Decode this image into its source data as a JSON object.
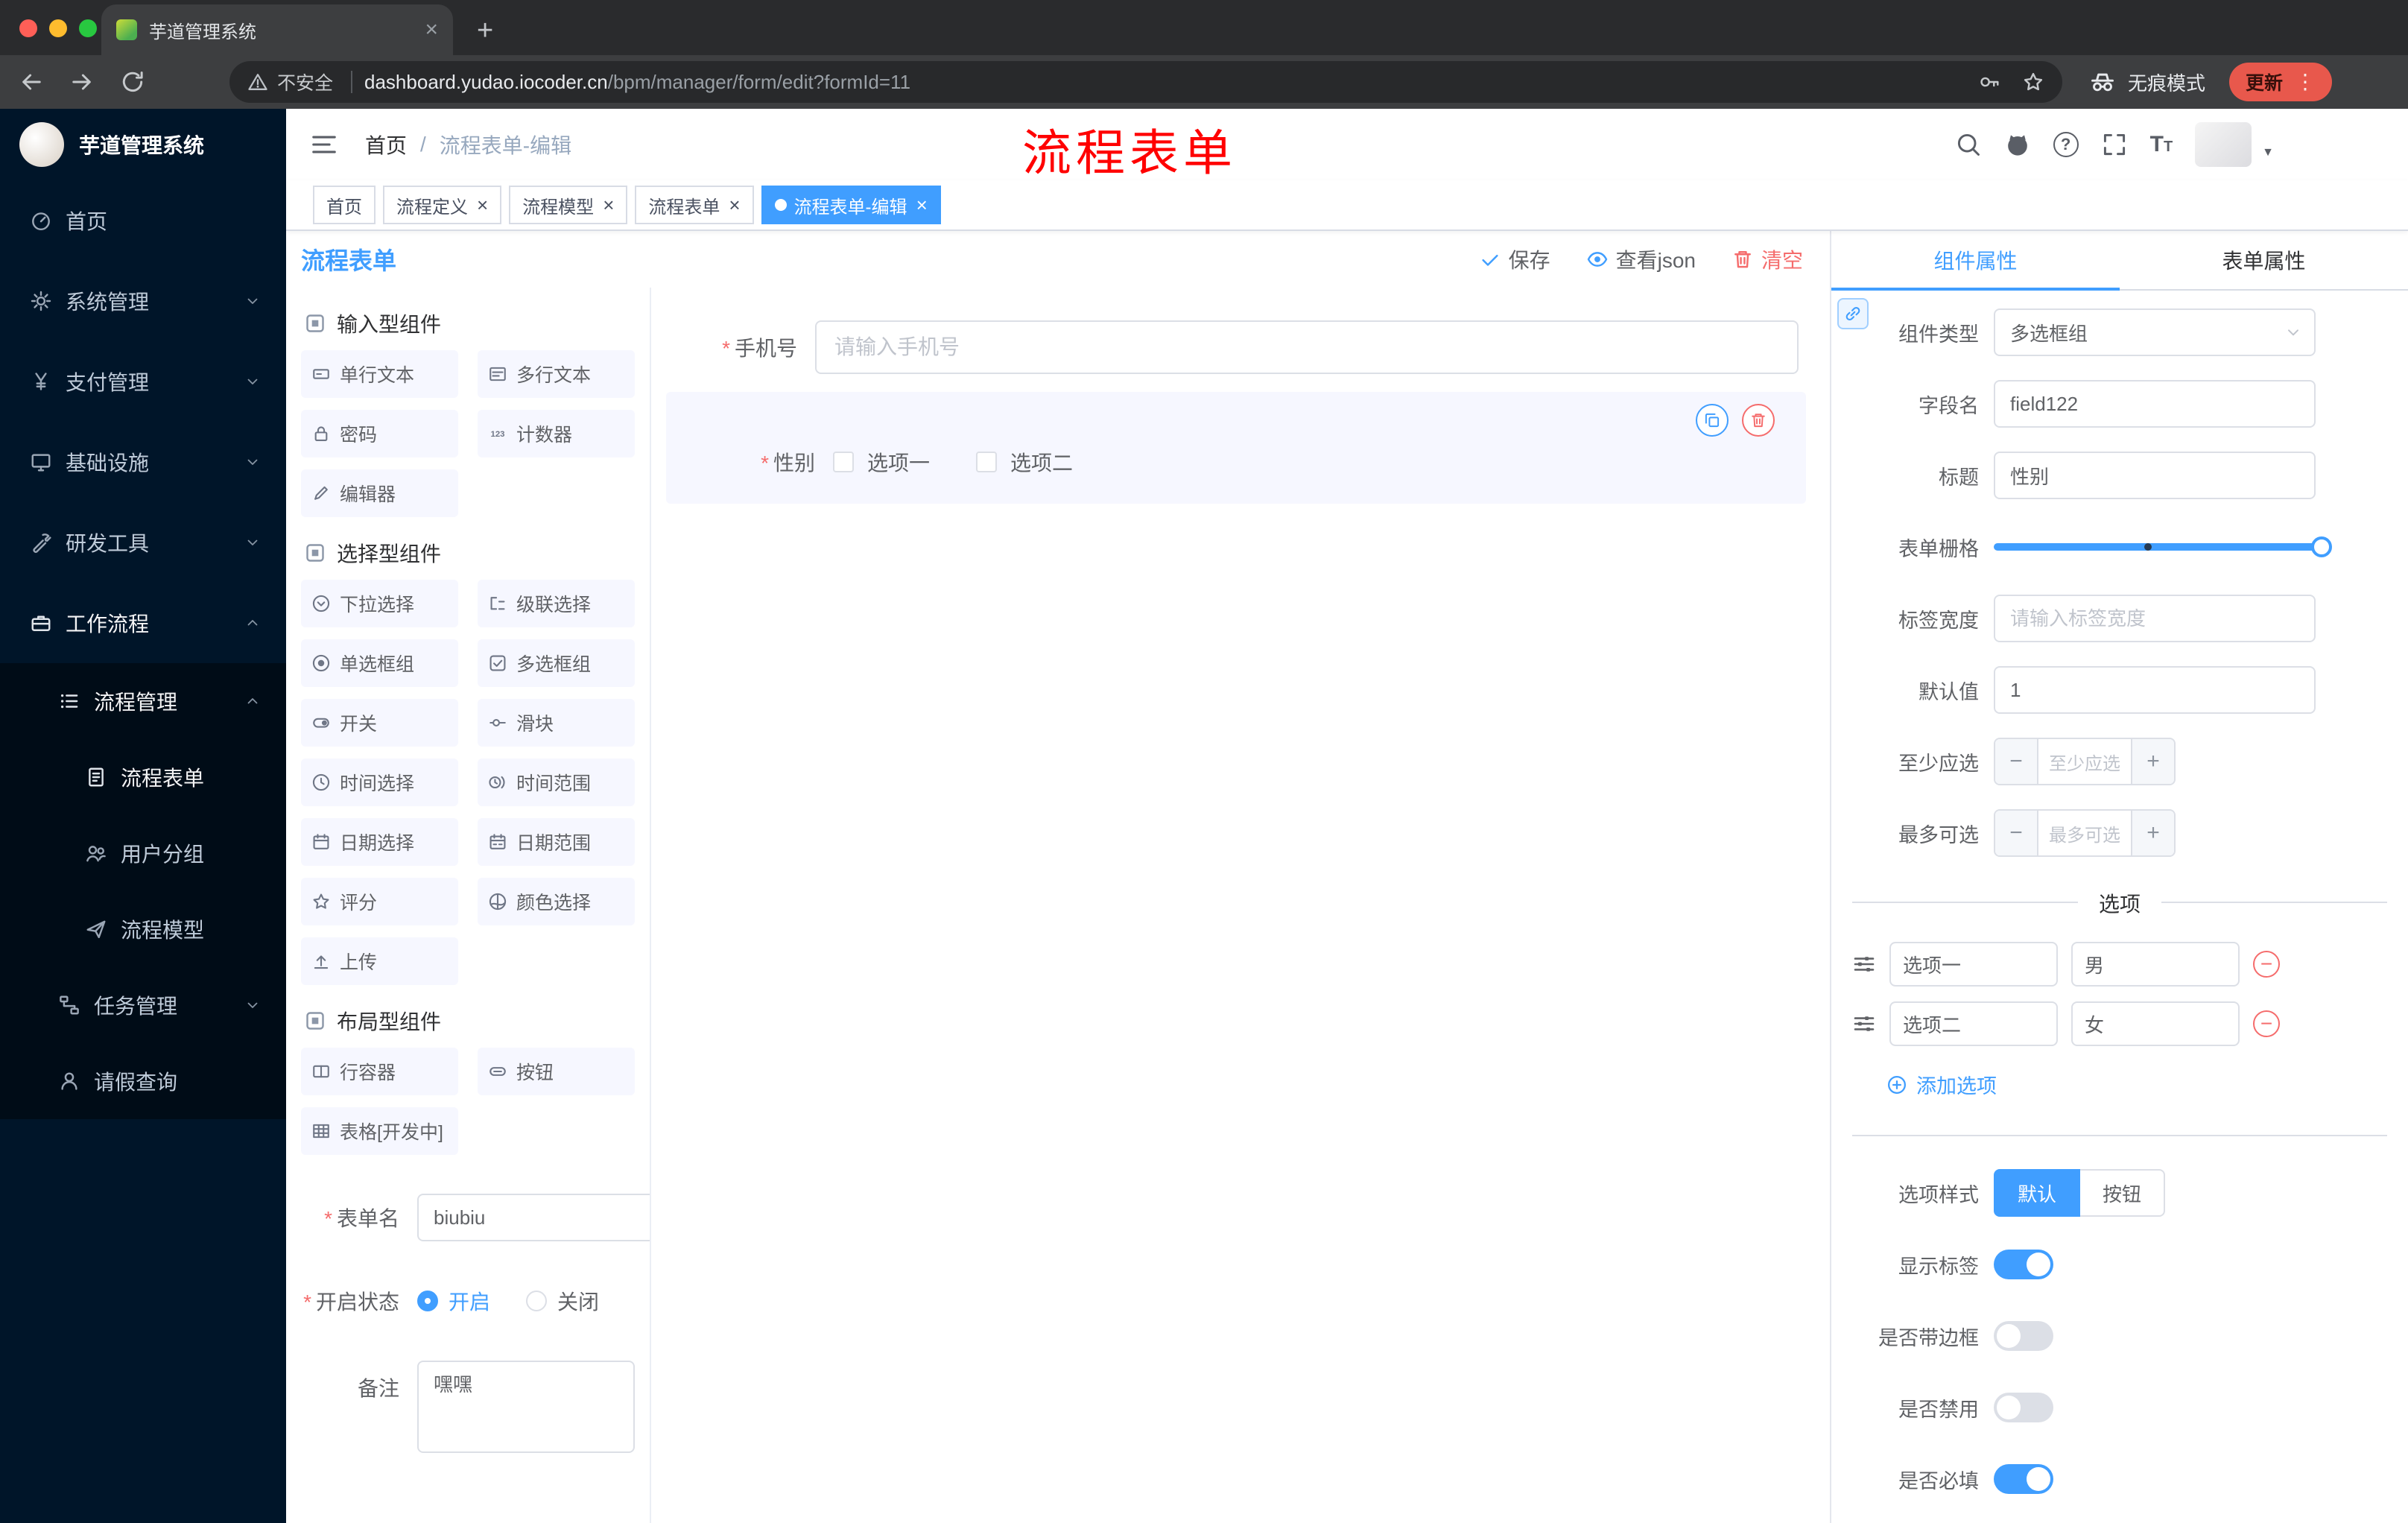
{
  "browser": {
    "tab_title": "芋道管理系统",
    "security_label": "不安全",
    "url_host": "dashboard.yudao.iocoder.cn",
    "url_path": "/bpm/manager/form/edit?formId=11",
    "incognito_label": "无痕模式",
    "update_label": "更新"
  },
  "sidebar": {
    "logo_title": "芋道管理系统",
    "items": [
      {
        "key": "home",
        "label": "首页",
        "icon": "dashboard",
        "depth": 0
      },
      {
        "key": "system",
        "label": "系统管理",
        "icon": "gear",
        "depth": 0,
        "chevron": "down"
      },
      {
        "key": "payment",
        "label": "支付管理",
        "icon": "yen",
        "depth": 0,
        "chevron": "down"
      },
      {
        "key": "infrastructure",
        "label": "基础设施",
        "icon": "infra",
        "depth": 0,
        "chevron": "down"
      },
      {
        "key": "devtools",
        "label": "研发工具",
        "icon": "tool",
        "depth": 0,
        "chevron": "down"
      },
      {
        "key": "workflow",
        "label": "工作流程",
        "icon": "workflow",
        "depth": 0,
        "chevron": "up",
        "trail": true
      },
      {
        "key": "process-management",
        "label": "流程管理",
        "icon": "process",
        "depth": 1,
        "chevron": "up",
        "trail": true
      },
      {
        "key": "process-form",
        "label": "流程表单",
        "icon": "form",
        "depth": 2,
        "active": true
      },
      {
        "key": "user-group",
        "label": "用户分组",
        "icon": "users",
        "depth": 2
      },
      {
        "key": "process-model",
        "label": "流程模型",
        "icon": "send",
        "depth": 2
      },
      {
        "key": "task-management",
        "label": "任务管理",
        "icon": "task",
        "depth": 1,
        "chevron": "down"
      },
      {
        "key": "leave-query",
        "label": "请假查询",
        "icon": "user",
        "depth": 1
      }
    ]
  },
  "header": {
    "breadcrumb": [
      "首页",
      "流程表单-编辑"
    ],
    "annotation": "流程表单"
  },
  "tags": [
    {
      "label": "首页",
      "closable": false,
      "active": false
    },
    {
      "label": "流程定义",
      "closable": true,
      "active": false
    },
    {
      "label": "流程模型",
      "closable": true,
      "active": false
    },
    {
      "label": "流程表单",
      "closable": true,
      "active": false
    },
    {
      "label": "流程表单-编辑",
      "closable": true,
      "active": true
    }
  ],
  "workspace": {
    "title": "流程表单",
    "actions": {
      "save": "保存",
      "view_json": "查看json",
      "clear": "清空"
    }
  },
  "palette": {
    "sections": [
      {
        "title": "输入型组件",
        "items": [
          {
            "label": "单行文本",
            "icon": "input"
          },
          {
            "label": "多行文本",
            "icon": "textarea"
          },
          {
            "label": "密码",
            "icon": "lock"
          },
          {
            "label": "计数器",
            "icon": "counter"
          },
          {
            "label": "编辑器",
            "icon": "editor"
          }
        ]
      },
      {
        "title": "选择型组件",
        "items": [
          {
            "label": "下拉选择",
            "icon": "select"
          },
          {
            "label": "级联选择",
            "icon": "cascade"
          },
          {
            "label": "单选框组",
            "icon": "radio"
          },
          {
            "label": "多选框组",
            "icon": "checkbox"
          },
          {
            "label": "开关",
            "icon": "switch"
          },
          {
            "label": "滑块",
            "icon": "slider"
          },
          {
            "label": "时间选择",
            "icon": "clock"
          },
          {
            "label": "时间范围",
            "icon": "clock-range"
          },
          {
            "label": "日期选择",
            "icon": "calendar"
          },
          {
            "label": "日期范围",
            "icon": "calendar-range"
          },
          {
            "label": "评分",
            "icon": "star"
          },
          {
            "label": "颜色选择",
            "icon": "color"
          },
          {
            "label": "上传",
            "icon": "upload"
          }
        ]
      },
      {
        "title": "布局型组件",
        "items": [
          {
            "label": "行容器",
            "icon": "row"
          },
          {
            "label": "按钮",
            "icon": "button"
          },
          {
            "label": "表格[开发中]",
            "icon": "table"
          }
        ]
      }
    ]
  },
  "left_form": {
    "form_name_label": "表单名",
    "form_name_value": "biubiu",
    "status_label": "开启状态",
    "status_options": [
      "开启",
      "关闭"
    ],
    "remark_label": "备注",
    "remark_value": "嘿嘿"
  },
  "canvas": {
    "phone": {
      "label": "手机号",
      "placeholder": "请输入手机号",
      "required": true
    },
    "gender": {
      "label": "性别",
      "required": true,
      "options": [
        "选项一",
        "选项二"
      ]
    }
  },
  "panel": {
    "tabs": [
      "组件属性",
      "表单属性"
    ],
    "fields": {
      "component_type": {
        "label": "组件类型",
        "value": "多选框组"
      },
      "field_name": {
        "label": "字段名",
        "value": "field122"
      },
      "title": {
        "label": "标题",
        "value": "性别"
      },
      "grid": {
        "label": "表单栅格",
        "value": 24,
        "max": 24,
        "marker": 12
      },
      "label_width": {
        "label": "标签宽度",
        "placeholder": "请输入标签宽度"
      },
      "default_value": {
        "label": "默认值",
        "value": "1"
      },
      "min_select": {
        "label": "至少应选",
        "placeholder": "至少应选"
      },
      "max_select": {
        "label": "最多可选",
        "placeholder": "最多可选"
      }
    },
    "options_divider": "选项",
    "options": [
      {
        "label": "选项一",
        "value": "男"
      },
      {
        "label": "选项二",
        "value": "女"
      }
    ],
    "add_option": "添加选项",
    "option_style": {
      "label": "选项样式",
      "choices": [
        "默认",
        "按钮"
      ],
      "selected": "默认"
    },
    "switches": [
      {
        "label": "显示标签",
        "on": true
      },
      {
        "label": "是否带边框",
        "on": false
      },
      {
        "label": "是否禁用",
        "on": false
      },
      {
        "label": "是否必填",
        "on": true
      }
    ]
  },
  "colors": {
    "accent": "#409eff",
    "danger": "#f56c6c",
    "sidebar_bg": "#001529",
    "annotation": "#ff0000",
    "tag_active": "#409eff"
  }
}
